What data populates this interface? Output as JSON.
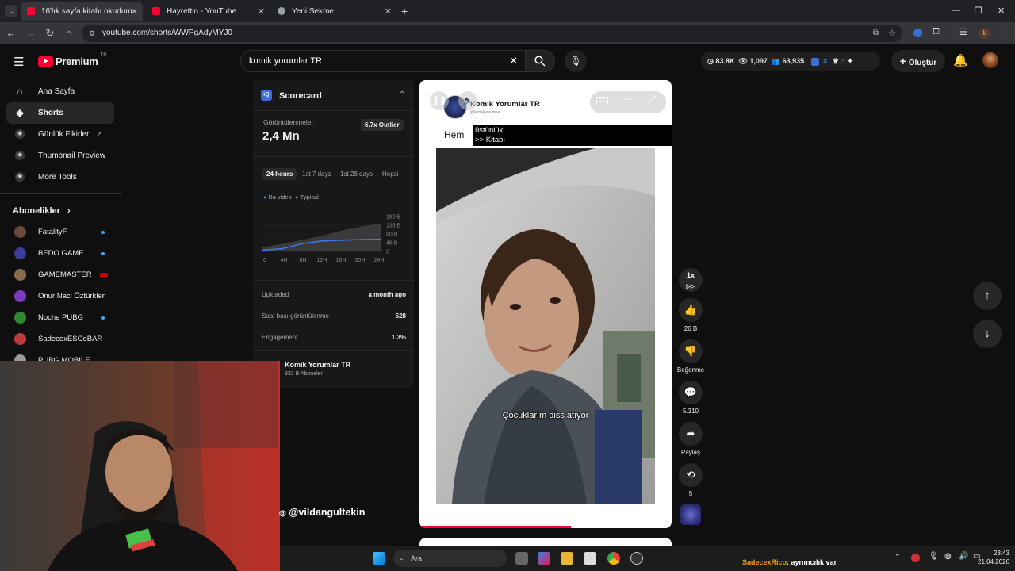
{
  "browser": {
    "tabs": [
      {
        "title": "16'lık sayfa kitabı okudum 📗",
        "fav_color": "#ff0033"
      },
      {
        "title": "Hayrettin - YouTube",
        "fav_color": "#ff0033"
      },
      {
        "title": "Yeni Sekme",
        "fav_color": "#9aa0a6"
      }
    ],
    "url": "youtube.com/shorts/WWPgAdyMYJ0",
    "profile_letter": "b"
  },
  "header": {
    "logo_text": "Premium",
    "logo_region": "TR",
    "search_value": "komik yorumlar TR",
    "stats": {
      "likes": "83.8K",
      "views": "1,097",
      "subs": "63,935"
    },
    "create_label": "Oluştur"
  },
  "sidebar": {
    "items": [
      {
        "label": "Ana Sayfa",
        "icon": "home-icon"
      },
      {
        "label": "Shorts",
        "icon": "shorts-icon"
      },
      {
        "label": "Günlük Fikirler",
        "icon": "vidiq-icon"
      },
      {
        "label": "Thumbnail Preview",
        "icon": "vidiq-icon"
      },
      {
        "label": "More Tools",
        "icon": "vidiq-icon"
      }
    ],
    "subs_heading": "Abonelikler",
    "subs": [
      {
        "label": "FatalityF",
        "color": "#6a4a3a"
      },
      {
        "label": "BEDO GAME",
        "color": "#3b3b9a"
      },
      {
        "label": "GAMEMASTER",
        "color": "#8a6a4a"
      },
      {
        "label": "Onur Naci Öztürkler",
        "color": "#7a3bbf"
      },
      {
        "label": "Noche PUBG",
        "color": "#2f8a2f"
      },
      {
        "label": "SadecexESCoBAR",
        "color": "#bf3b3b"
      },
      {
        "label": "PUBG MOBILE",
        "color": "#999999"
      }
    ]
  },
  "scorecard": {
    "title": "Scorecard",
    "views_label": "Görüntülenmeler",
    "views_value": "2,4 Mn",
    "outlier": "6.7x Outlier",
    "ranges": [
      "24 hours",
      "1st 7 days",
      "1st 28 days",
      "Hepsi"
    ],
    "legend": [
      "Bu video",
      "Typical"
    ],
    "y_ticks": [
      "180 B",
      "135 B",
      "90 B",
      "45 B",
      "0"
    ],
    "x_ticks": [
      "0",
      "4H",
      "8H",
      "12H",
      "16H",
      "20H",
      "24H"
    ],
    "rows": [
      {
        "label": "Uploaded",
        "value": "a month ago"
      },
      {
        "label": "Saat başı görüntülenme",
        "value": "528"
      },
      {
        "label": "Engagement",
        "value": "1.3%"
      }
    ],
    "channel_name": "Komik Yorumlar TR",
    "channel_subs": "832 B Aboneler"
  },
  "video": {
    "channel": "Komik Yorumlar TR",
    "channel_handle": "@komikyorumlar",
    "overlay_text_1": "Hem",
    "overlay_line_1": "üstünlük.",
    "overlay_line_2": ">> Kitabı",
    "caption": "Çocuklarım diss atıyor",
    "watermark": "@vildangultekin"
  },
  "actions": {
    "speed": "1x",
    "like_count": "26 B",
    "dislike_label": "Beğenme",
    "comment_count": "5.310",
    "share_label": "Paylaş",
    "remix_count": "5"
  },
  "taskbar": {
    "search_placeholder": "Ara",
    "chat_user": "SadecexRico",
    "chat_message": ": ayrımcılık var",
    "time": "23:43",
    "date": "21.04.2026"
  }
}
